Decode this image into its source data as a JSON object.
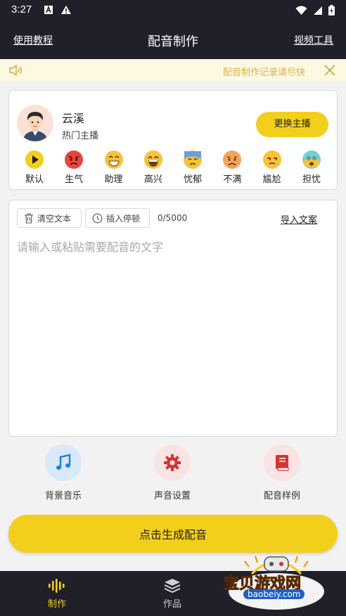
{
  "status_bar": {
    "time": "3:27"
  },
  "header": {
    "left_link": "使用教程",
    "title": "配音制作",
    "right_link": "视频工具"
  },
  "notice": {
    "text": "配音制作记录请尽快"
  },
  "anchor": {
    "name": "云溪",
    "tag": "热门主播",
    "change_label": "更换主播",
    "emotions": [
      {
        "label": "默认",
        "icon": "play-icon"
      },
      {
        "label": "生气",
        "icon": "angry-face-icon"
      },
      {
        "label": "助理",
        "icon": "grin-face-icon"
      },
      {
        "label": "高兴",
        "icon": "laugh-face-icon"
      },
      {
        "label": "忧郁",
        "icon": "sweat-face-icon"
      },
      {
        "label": "不满",
        "icon": "sad-face-icon"
      },
      {
        "label": "尴尬",
        "icon": "unamused-face-icon"
      },
      {
        "label": "担忧",
        "icon": "worried-face-icon"
      }
    ]
  },
  "editor": {
    "clear_label": "清空文本",
    "pause_label": "插入停顿",
    "counter": "0/5000",
    "import_label": "导入文案",
    "placeholder": "请输入或粘贴需要配音的文字"
  },
  "tools": [
    {
      "label": "背景音乐",
      "icon": "music-note-icon"
    },
    {
      "label": "声音设置",
      "icon": "gear-icon"
    },
    {
      "label": "配音样例",
      "icon": "book-icon"
    }
  ],
  "generate_label": "点击生成配音",
  "nav": {
    "items": [
      {
        "label": "制作",
        "icon": "waveform-icon"
      },
      {
        "label": "作品",
        "icon": "layers-icon"
      },
      {
        "label": "我的",
        "icon": "person-icon"
      }
    ]
  },
  "watermark": {
    "text": "宝贝游戏网",
    "sub": "baobeiy.com"
  },
  "colors": {
    "accent": "#f2cf1d",
    "dark": "#1f2029",
    "notice_bg": "#fdf8e1",
    "notice_text": "#d9b34a"
  }
}
